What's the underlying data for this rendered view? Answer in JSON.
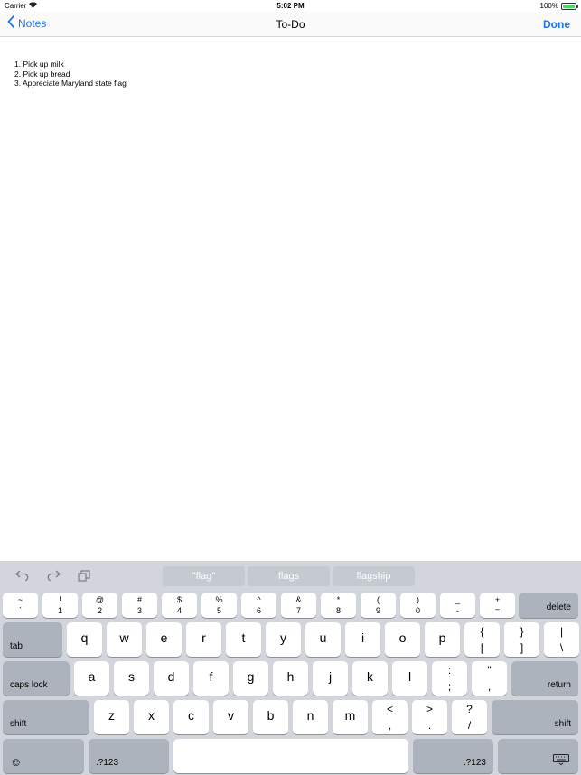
{
  "status_bar": {
    "carrier": "Carrier",
    "time": "5:02 PM",
    "battery": "100%",
    "battery_level": 1.0
  },
  "nav": {
    "back_label": "Notes",
    "title": "To-Do",
    "done_label": "Done"
  },
  "note": {
    "lines": [
      "1. Pick up milk",
      "2. Pick up bread",
      "3. Appreciate Maryland state flag"
    ]
  },
  "keyboard": {
    "suggestions": [
      "\"flag\"",
      "flags",
      "flagship"
    ],
    "number_row": [
      {
        "top": "~",
        "bottom": "`"
      },
      {
        "top": "!",
        "bottom": "1"
      },
      {
        "top": "@",
        "bottom": "2"
      },
      {
        "top": "#",
        "bottom": "3"
      },
      {
        "top": "$",
        "bottom": "4"
      },
      {
        "top": "%",
        "bottom": "5"
      },
      {
        "top": "^",
        "bottom": "6"
      },
      {
        "top": "&",
        "bottom": "7"
      },
      {
        "top": "*",
        "bottom": "8"
      },
      {
        "top": "(",
        "bottom": "9"
      },
      {
        "top": ")",
        "bottom": "0"
      },
      {
        "top": "_",
        "bottom": "-"
      },
      {
        "top": "+",
        "bottom": "="
      }
    ],
    "delete_label": "delete",
    "tab_label": "tab",
    "row_q": [
      "q",
      "w",
      "e",
      "r",
      "t",
      "y",
      "u",
      "i",
      "o",
      "p"
    ],
    "row_q_symbols": [
      {
        "top": "{",
        "bottom": "["
      },
      {
        "top": "}",
        "bottom": "]"
      },
      {
        "top": "|",
        "bottom": "\\"
      }
    ],
    "caps_label": "caps lock",
    "row_a": [
      "a",
      "s",
      "d",
      "f",
      "g",
      "h",
      "j",
      "k",
      "l"
    ],
    "row_a_symbols": [
      {
        "top": ":",
        "bottom": ";"
      },
      {
        "top": "\"",
        "bottom": ","
      }
    ],
    "return_label": "return",
    "shift_label": "shift",
    "row_z": [
      "z",
      "x",
      "c",
      "v",
      "b",
      "n",
      "m"
    ],
    "row_z_symbols": [
      {
        "top": "<",
        "bottom": ","
      },
      {
        "top": ">",
        "bottom": "."
      },
      {
        "top": "?",
        "bottom": "/"
      }
    ],
    "numbers_label": ".?123"
  }
}
